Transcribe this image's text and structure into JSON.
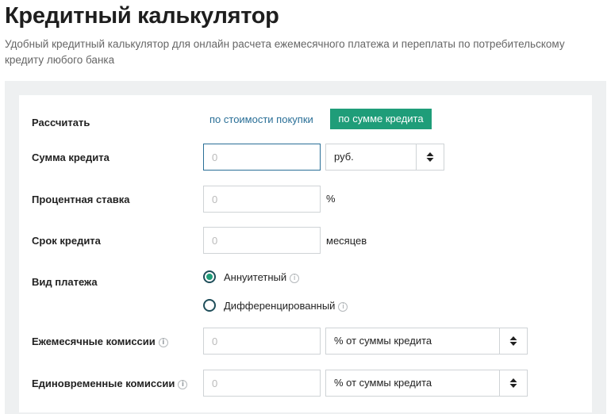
{
  "title": "Кредитный калькулятор",
  "subtitle": "Удобный кредитный калькулятор для онлайн расчета ежемесячного платежа и переплаты по потребительскому кредиту любого банка",
  "calc_mode": {
    "label": "Рассчитать",
    "tab_purchase": "по стоимости покупки",
    "tab_credit": "по сумме кредита"
  },
  "loan_amount": {
    "label": "Сумма кредита",
    "placeholder": "0",
    "currency": "руб."
  },
  "interest_rate": {
    "label": "Процентная ставка",
    "placeholder": "0",
    "unit": "%"
  },
  "loan_term": {
    "label": "Срок кредита",
    "placeholder": "0",
    "unit": "месяцев"
  },
  "payment_type": {
    "label": "Вид платежа",
    "option_annuity": "Аннуитетный",
    "option_diff": "Дифференцированный",
    "selected": "annuity"
  },
  "monthly_fees": {
    "label": "Ежемесячные комиссии",
    "placeholder": "0",
    "type": "% от суммы кредита"
  },
  "onetime_fees": {
    "label": "Единовременные комиссии",
    "placeholder": "0",
    "type": "% от суммы кредита"
  },
  "colors": {
    "accent": "#1f9d79",
    "link": "#2a6f97"
  },
  "icons": {
    "info": "i"
  }
}
